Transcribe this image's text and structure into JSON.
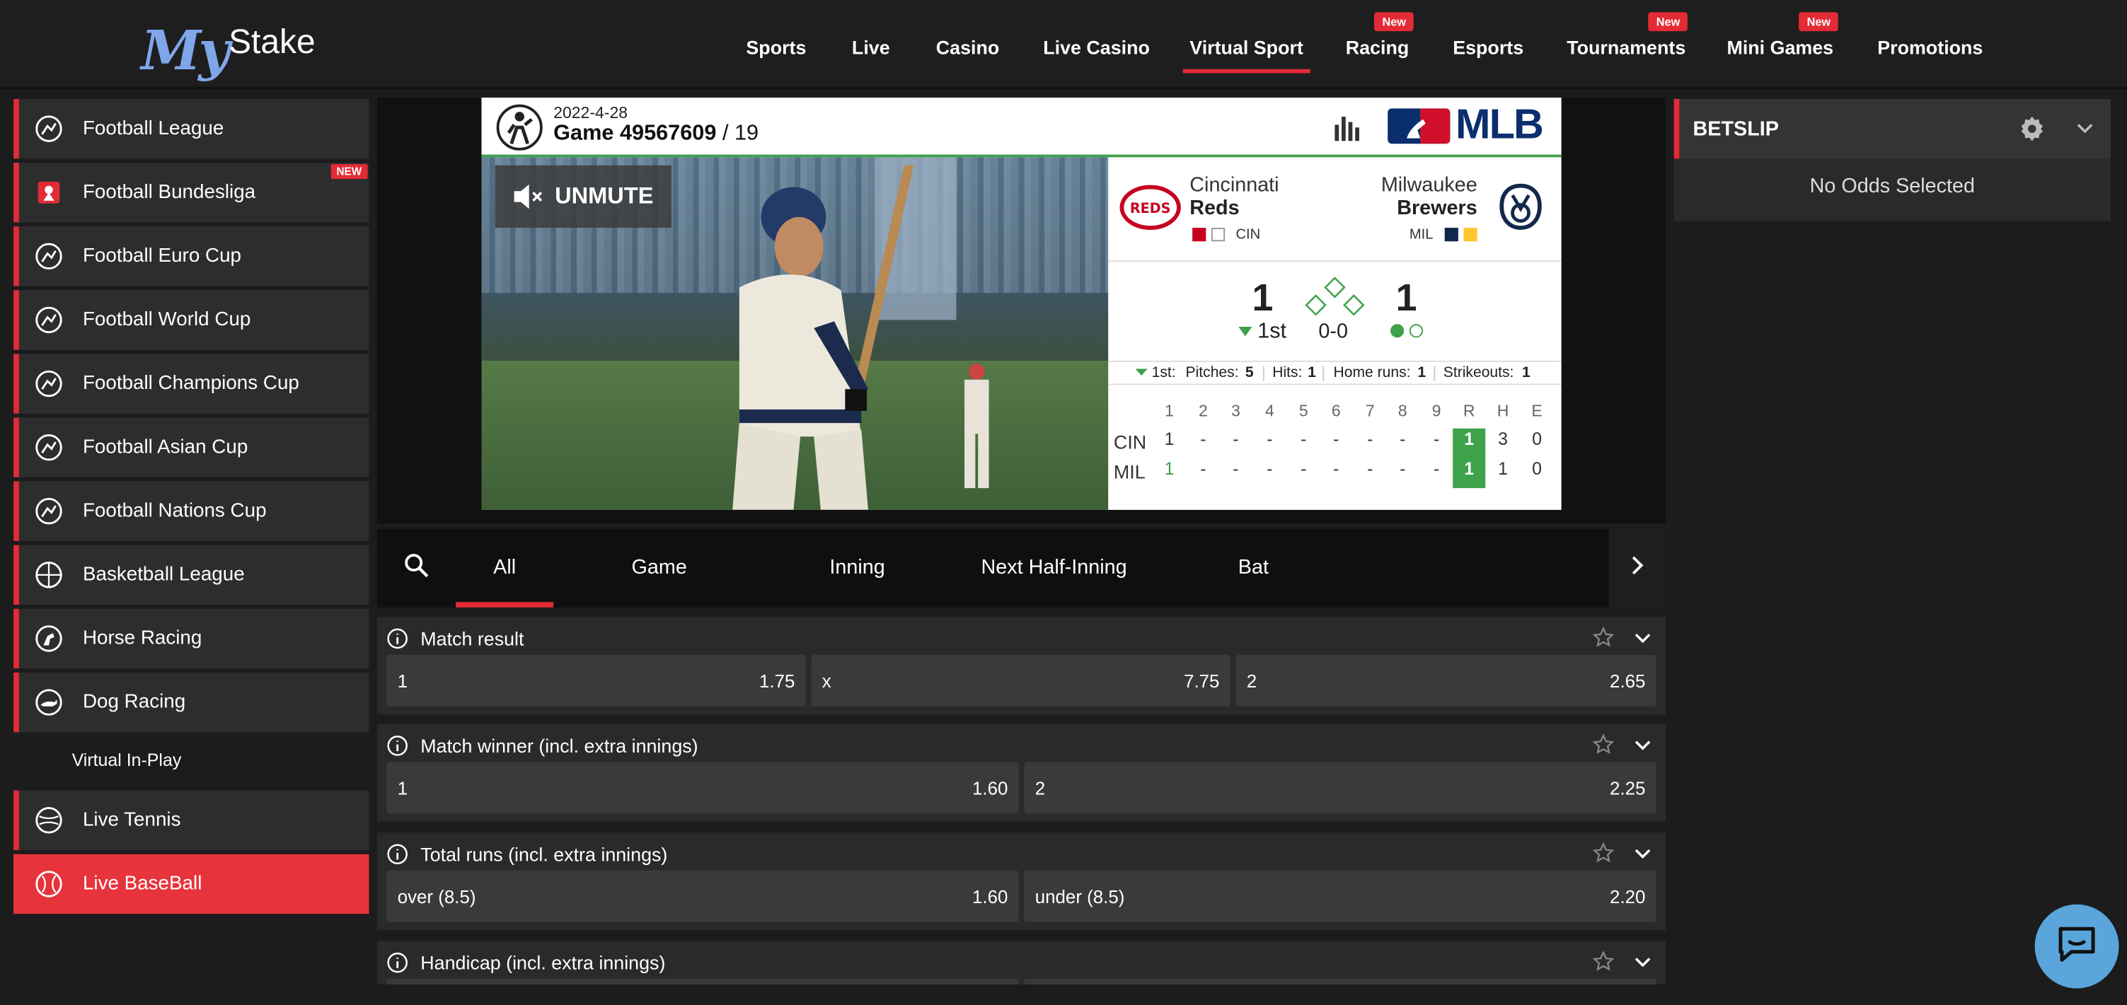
{
  "brand": {
    "logo_my": "My",
    "logo_stake": "Stake"
  },
  "nav": [
    {
      "label": "Sports"
    },
    {
      "label": "Live"
    },
    {
      "label": "Casino"
    },
    {
      "label": "Live Casino"
    },
    {
      "label": "Virtual Sport",
      "active": true
    },
    {
      "label": "Racing",
      "badge": "New"
    },
    {
      "label": "Esports"
    },
    {
      "label": "Tournaments",
      "badge": "New"
    },
    {
      "label": "Mini Games",
      "badge": "New"
    },
    {
      "label": "Promotions"
    }
  ],
  "sidebar": {
    "items": [
      {
        "label": "Football League",
        "icon": "football-icon"
      },
      {
        "label": "Football Bundesliga",
        "icon": "bundesliga-icon",
        "badge": "NEW"
      },
      {
        "label": "Football Euro Cup",
        "icon": "football-icon"
      },
      {
        "label": "Football World Cup",
        "icon": "football-icon"
      },
      {
        "label": "Football Champions Cup",
        "icon": "football-icon"
      },
      {
        "label": "Football Asian Cup",
        "icon": "football-icon"
      },
      {
        "label": "Football Nations Cup",
        "icon": "football-icon"
      },
      {
        "label": "Basketball League",
        "icon": "basketball-icon"
      },
      {
        "label": "Horse Racing",
        "icon": "horse-icon"
      },
      {
        "label": "Dog Racing",
        "icon": "dog-icon"
      }
    ],
    "virtual_in_play": "Virtual In-Play",
    "live_items": [
      {
        "label": "Live Tennis",
        "icon": "tennis-icon"
      },
      {
        "label": "Live BaseBall",
        "icon": "baseball-icon",
        "active": true
      }
    ]
  },
  "game": {
    "date": "2022-4-28",
    "title": "Game 49567609",
    "round": " / 19",
    "league": "MLB",
    "unmute": "UNMUTE",
    "home": {
      "city": "Cincinnati",
      "name": "Reds",
      "abbr": "CIN"
    },
    "away": {
      "city": "Milwaukee",
      "name": "Brewers",
      "abbr": "MIL"
    },
    "score_home": "1",
    "score_away": "1",
    "inning": "1st",
    "count": "0-0",
    "stats": {
      "inning": "1st:",
      "pitches_l": "Pitches:",
      "pitches": "5",
      "hits_l": "Hits:",
      "hits": "1",
      "hr_l": "Home runs:",
      "hr": "1",
      "so_l": "Strikeouts:",
      "so": "1"
    },
    "linescore": {
      "headers": [
        "1",
        "2",
        "3",
        "4",
        "5",
        "6",
        "7",
        "8",
        "9",
        "R",
        "H",
        "E"
      ],
      "rows": [
        {
          "team": "CIN",
          "cells": [
            "1",
            "-",
            "-",
            "-",
            "-",
            "-",
            "-",
            "-",
            "-",
            "1",
            "3",
            "0"
          ]
        },
        {
          "team": "MIL",
          "cells": [
            "1",
            "-",
            "-",
            "-",
            "-",
            "-",
            "-",
            "-",
            "-",
            "1",
            "1",
            "0"
          ]
        }
      ]
    }
  },
  "tabs": [
    "All",
    "Game",
    "Inning",
    "Next Half-Inning",
    "Bat"
  ],
  "markets": [
    {
      "title": "Match result",
      "odds": [
        {
          "label": "1",
          "value": "1.75"
        },
        {
          "label": "x",
          "value": "7.75"
        },
        {
          "label": "2",
          "value": "2.65"
        }
      ]
    },
    {
      "title": "Match winner (incl. extra innings)",
      "odds": [
        {
          "label": "1",
          "value": "1.60"
        },
        {
          "label": "2",
          "value": "2.25"
        }
      ]
    },
    {
      "title": "Total runs (incl. extra innings)",
      "odds": [
        {
          "label": "over (8.5)",
          "value": "1.60"
        },
        {
          "label": "under (8.5)",
          "value": "2.20"
        }
      ]
    },
    {
      "title": "Handicap (incl. extra innings)",
      "odds": []
    }
  ],
  "betslip": {
    "title": "BETSLIP",
    "empty": "No Odds Selected"
  },
  "colors": {
    "accent": "#e32b36",
    "win_green": "#3ea24a",
    "bg": "#1c1c1c"
  }
}
